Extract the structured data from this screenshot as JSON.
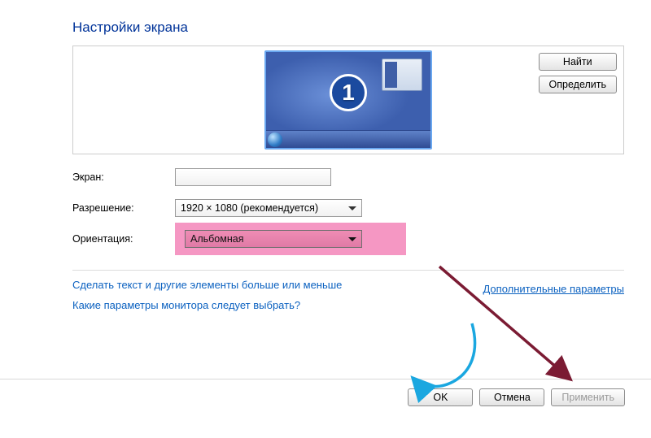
{
  "title": "Настройки экрана",
  "monitor_number": "1",
  "find_button": "Найти",
  "detect_button": "Определить",
  "screen": {
    "label": "Экран:",
    "value": ""
  },
  "resolution": {
    "label": "Разрешение:",
    "value": "1920 × 1080 (рекомендуется)"
  },
  "orientation": {
    "label": "Ориентация:",
    "value": "Альбомная"
  },
  "advanced_link": "Дополнительные параметры",
  "help_links": {
    "text_size": "Сделать текст и другие элементы больше или меньше",
    "which_settings": "Какие параметры монитора следует выбрать?"
  },
  "footer": {
    "ok": "OK",
    "cancel": "Отмена",
    "apply": "Применить"
  }
}
